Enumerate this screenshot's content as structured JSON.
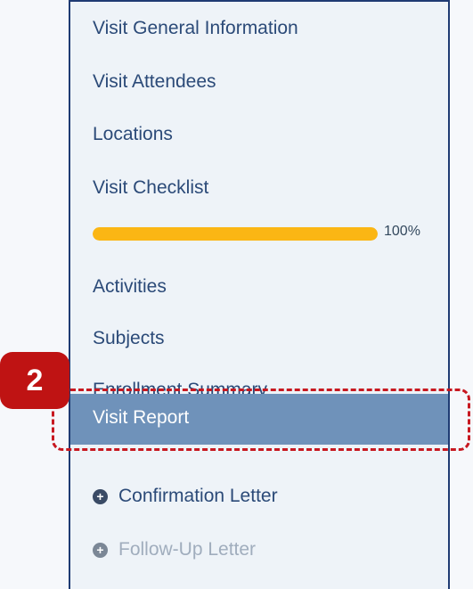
{
  "sidebar": {
    "items": [
      {
        "label": "Visit General Information"
      },
      {
        "label": "Visit Attendees"
      },
      {
        "label": "Locations"
      },
      {
        "label": "Visit Checklist"
      },
      {
        "label": "Activities"
      },
      {
        "label": "Subjects"
      },
      {
        "label": "Enrollment Summary"
      }
    ],
    "checklist_progress": {
      "value": 1.0,
      "label": "100%"
    },
    "active_item": {
      "label": "Visit Report"
    },
    "letters": [
      {
        "label": "Confirmation Letter",
        "icon": "plus-circle-icon"
      },
      {
        "label": "Follow-Up Letter",
        "icon": "plus-circle-icon"
      }
    ]
  },
  "annotation": {
    "step_number": "2"
  },
  "colors": {
    "accent": "#6f92ba",
    "progress": "#fbb614",
    "annotation": "#bf1313",
    "text": "#2b4a78",
    "disabled_text": "#a0adbd"
  }
}
